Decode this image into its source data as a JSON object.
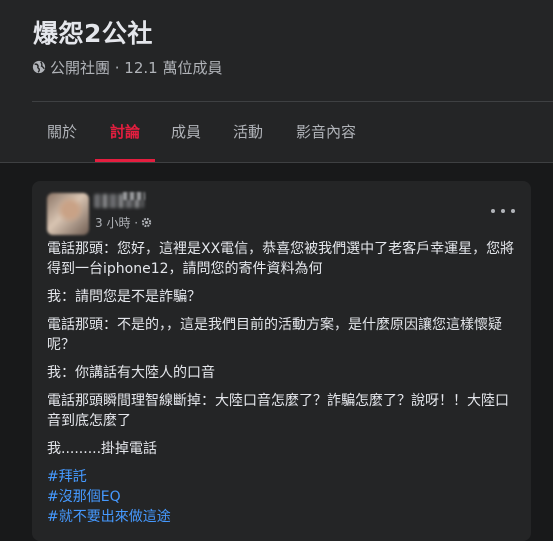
{
  "header": {
    "group_title": "爆怨2公社",
    "meta_text": "公開社團 · 12.1 萬位成員",
    "globe_icon": "globe-icon",
    "tabs": [
      {
        "label": "關於"
      },
      {
        "label": "討論"
      },
      {
        "label": "成員"
      },
      {
        "label": "活動"
      },
      {
        "label": "影音內容"
      }
    ],
    "active_tab": "討論",
    "accent_color": "#e41e3f"
  },
  "post": {
    "timestamp": "3 小時 ·",
    "privacy_icon": "gear-icon",
    "more_icon": "more-horizontal-icon",
    "paragraphs": [
      "電話那頭：您好，這裡是XX電信，恭喜您被我們選中了老客戶幸運星，您將得到一台iphone12，請問您的寄件資料為何",
      "我：請問您是不是詐騙？",
      "電話那頭：不是的，，這是我們目前的活動方案，是什麼原因讓您這樣懷疑呢？",
      "我：你講話有大陸人的口音",
      "電話那頭瞬間理智線斷掉：大陸口音怎麼了？詐騙怎麼了？說呀！！大陸口音到底怎麼了",
      "我.........掛掉電話"
    ],
    "hashtags": [
      "#拜託",
      "#沒那個EQ",
      "#就不要出來做這途"
    ],
    "link_color": "#4599ff"
  }
}
